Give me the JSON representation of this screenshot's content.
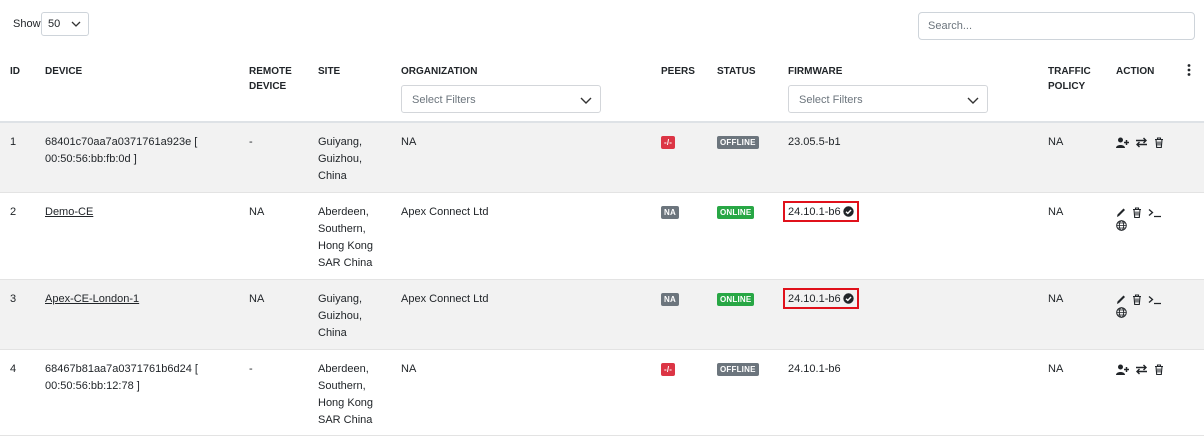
{
  "toolbar": {
    "show_label": "Show",
    "page_size": "50",
    "search_placeholder": "Search..."
  },
  "columns": {
    "id": "ID",
    "device": "DEVICE",
    "remote_device_1": "REMOTE",
    "remote_device_2": "DEVICE",
    "site": "SITE",
    "organization": "ORGANIZATION",
    "peers": "PEERS",
    "status": "STATUS",
    "firmware": "FIRMWARE",
    "traffic_policy_1": "TRAFFIC",
    "traffic_policy_2": "POLICY",
    "action": "ACTION"
  },
  "filters": {
    "organization_placeholder": "Select Filters",
    "firmware_placeholder": "Select Filters"
  },
  "rows": [
    {
      "id": "1",
      "device_1": "68401c70aa7a0371761a923e [",
      "device_2": "00:50:56:bb:fb:0d ]",
      "remote_device": "-",
      "site_1": "Guiyang,",
      "site_2": "Guizhou,",
      "site_3": "China",
      "organization": "NA",
      "peers": "-/-",
      "status": "OFFLINE",
      "firmware": "23.05.5-b1",
      "traffic_policy": "NA"
    },
    {
      "id": "2",
      "device": "Demo-CE",
      "remote_device": "NA",
      "site_1": "Aberdeen,",
      "site_2": "Southern,",
      "site_3": "Hong Kong",
      "site_4": "SAR China",
      "organization": "Apex Connect Ltd",
      "peers": "NA",
      "status": "ONLINE",
      "firmware": "24.10.1-b6",
      "traffic_policy": "NA"
    },
    {
      "id": "3",
      "device": "Apex-CE-London-1",
      "remote_device": "NA",
      "site_1": "Guiyang,",
      "site_2": "Guizhou,",
      "site_3": "China",
      "organization": "Apex Connect Ltd",
      "peers": "NA",
      "status": "ONLINE",
      "firmware": "24.10.1-b6",
      "traffic_policy": "NA"
    },
    {
      "id": "4",
      "device_1": "68467b81aa7a0371761b6d24 [",
      "device_2": "00:50:56:bb:12:78 ]",
      "remote_device": "-",
      "site_1": "Aberdeen,",
      "site_2": "Southern,",
      "site_3": "Hong Kong",
      "site_4": "SAR China",
      "organization": "NA",
      "peers": "-/-",
      "status": "OFFLINE",
      "firmware": "24.10.1-b6",
      "traffic_policy": "NA"
    }
  ],
  "colors": {
    "offline": "#6c757d",
    "online": "#28a745",
    "peers_down": "#dc3545",
    "highlight_box": "#e0111b",
    "alt_row": "#f2f2f2"
  },
  "icons": [
    "chevron-down-icon",
    "user-plus-icon",
    "swap-icon",
    "trash-icon",
    "pencil-icon",
    "terminal-icon",
    "globe-icon",
    "check-circle-icon",
    "kebab-menu-icon"
  ]
}
